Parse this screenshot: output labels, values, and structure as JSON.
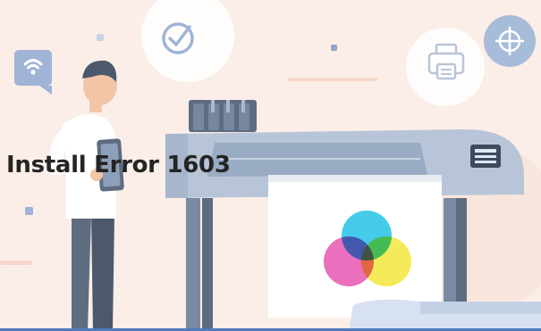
{
  "title": "Install Error 1603",
  "colors": {
    "background": "#fbeee8",
    "accent": "#4f7bc0",
    "printer_body": "#b8c5d8",
    "printer_dark": "#5e6c80",
    "cmy_cyan": "#33c6e9",
    "cmy_magenta": "#e85fb5",
    "cmy_yellow": "#f4e948"
  },
  "icons": [
    "wifi-icon",
    "checkmark-icon",
    "printer-icon",
    "crosshair-icon"
  ]
}
